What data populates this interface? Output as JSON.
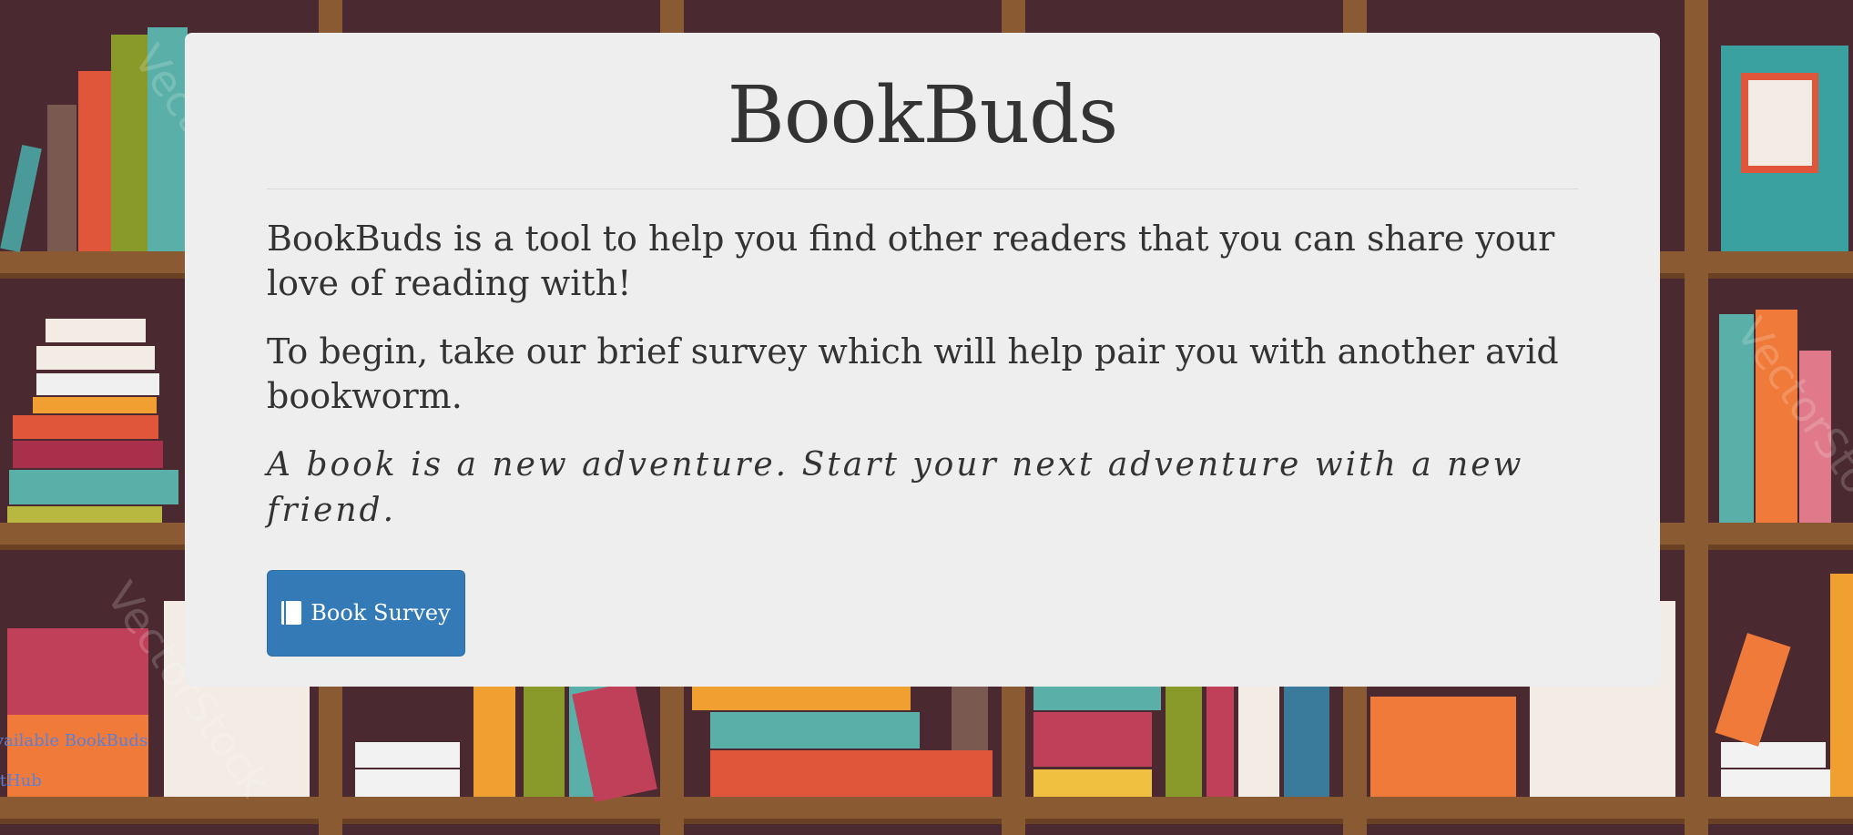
{
  "page": {
    "title": "BookBuds",
    "intro": "BookBuds is a tool to help you find other readers that you can share your love of reading with!",
    "instruction": "To begin, take our brief survey which will help pair you with another avid bookworm.",
    "quote": "A book is a new adventure. Start your next adventure with a new friend.",
    "survey_button": {
      "label": "Book Survey",
      "icon": "book-icon"
    }
  },
  "footer": {
    "links": [
      {
        "label": "vailable BookBuds"
      },
      {
        "label": "itHub"
      }
    ]
  },
  "background": {
    "watermark": "VectorStock",
    "colors": {
      "panel": "#eeeeee",
      "primary": "#337ab7",
      "link": "#5b7fd6",
      "shelf": "#8a5a33",
      "backdrop": "#4a2a30"
    }
  }
}
